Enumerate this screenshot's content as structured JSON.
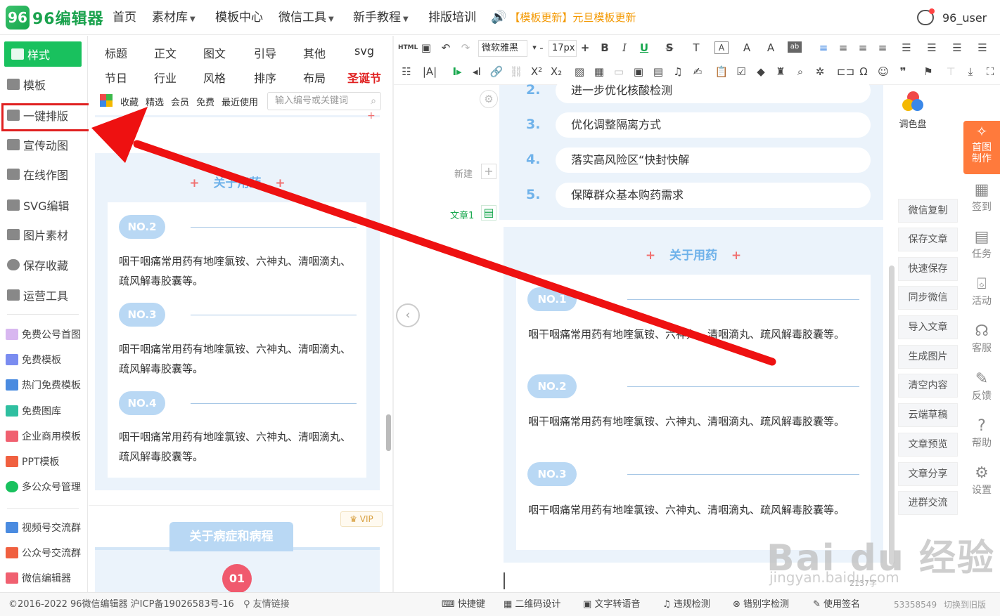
{
  "topnav": {
    "logo_text": "96编辑器",
    "logo_mark": "96",
    "items": [
      "首页",
      "素材库",
      "模板中心",
      "微信工具",
      "新手教程",
      "排版培训"
    ],
    "notice": "【模板更新】元旦模板更新",
    "username": "96_user"
  },
  "sidebar": {
    "main": [
      "样式",
      "模板",
      "一键排版",
      "宣传动图",
      "在线作图",
      "SVG编辑",
      "图片素材",
      "保存收藏",
      "运营工具"
    ],
    "links": [
      "免费公号首图",
      "免费模板",
      "热门免费模板",
      "免费图库",
      "企业商用模板",
      "PPT模板",
      "多公众号管理"
    ],
    "groups": [
      "视频号交流群",
      "公众号交流群",
      "微信编辑器"
    ]
  },
  "stylepanel": {
    "categories_row1": [
      "标题",
      "正文",
      "图文",
      "引导",
      "其他",
      "svg"
    ],
    "categories_row2": [
      "节日",
      "行业",
      "风格",
      "排序",
      "布局",
      "圣诞节"
    ],
    "subtabs": [
      "收藏",
      "精选",
      "会员",
      "免费",
      "最近使用"
    ],
    "search_placeholder": "输入编号或关键词",
    "template1": {
      "title": "关于用药",
      "items": [
        {
          "no": "NO.2",
          "text": "咽干咽痛常用药有地喹氯铵、六神丸、清咽滴丸、疏风解毒胶囊等。"
        },
        {
          "no": "NO.3",
          "text": "咽干咽痛常用药有地喹氯铵、六神丸、清咽滴丸、疏风解毒胶囊等。"
        },
        {
          "no": "NO.4",
          "text": "咽干咽痛常用药有地喹氯铵、六神丸、清咽滴丸、疏风解毒胶囊等。"
        }
      ]
    },
    "vip_label": "VIP",
    "template2": {
      "title": "关于病症和病程",
      "badge": "01"
    }
  },
  "toolbar": {
    "font_family": "微软雅黑",
    "font_size": "17px",
    "html_label": "HTML"
  },
  "editor": {
    "side_new": "新建",
    "side_article": "文章1",
    "list": [
      {
        "num": "2.",
        "text": "进一步优化核酸检测"
      },
      {
        "num": "3.",
        "text": "优化调整隔离方式"
      },
      {
        "num": "4.",
        "text": "落实高风险区“快封快解"
      },
      {
        "num": "5.",
        "text": "保障群众基本购药需求"
      }
    ],
    "section_title": "关于用药",
    "items": [
      {
        "no": "NO.1",
        "text": "咽干咽痛常用药有地喹氯铵、六神丸、清咽滴丸、疏风解毒胶囊等。"
      },
      {
        "no": "NO.2",
        "text": "咽干咽痛常用药有地喹氯铵、六神丸、清咽滴丸、疏风解毒胶囊等。"
      },
      {
        "no": "NO.3",
        "text": "咽干咽痛常用药有地喹氯铵、六神丸、清咽滴丸、疏风解毒胶囊等。"
      }
    ],
    "word_count": "2137字"
  },
  "righttools": {
    "palette": "调色盘",
    "buttons": [
      "微信复制",
      "保存文章",
      "快速保存",
      "同步微信",
      "导入文章",
      "生成图片",
      "清空内容",
      "云端草稿",
      "文章预览",
      "文章分享",
      "进群交流"
    ]
  },
  "rightbar": {
    "home_make": "首图制作",
    "items": [
      "签到",
      "任务",
      "活动",
      "客服",
      "反馈",
      "帮助",
      "设置"
    ]
  },
  "footer": {
    "copyright": "©2016-2022 96微信编辑器 沪ICP备19026583号-16",
    "friend_link": "友情链接",
    "tools": [
      "快捷键",
      "二维码设计",
      "文字转语音",
      "违规检测",
      "错别字检测",
      "使用签名"
    ],
    "id_number": "53358549",
    "old_version": "切换到旧版"
  },
  "watermark": {
    "main": "Bai du 经验",
    "sub": "jingyan.baidu.com"
  },
  "colors": {
    "brand": "#19c15e",
    "accent": "#6fb2ea",
    "annotation": "#e02020",
    "orange": "#ff7a3c"
  }
}
